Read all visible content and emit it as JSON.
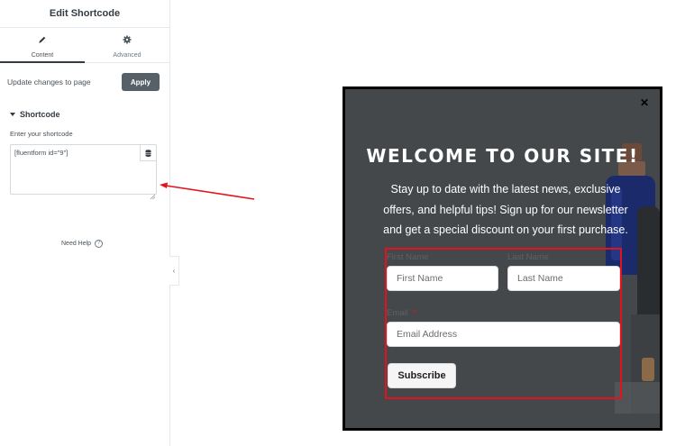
{
  "panel": {
    "title": "Edit Shortcode",
    "tabs": [
      {
        "label": "Content",
        "icon": "pencil-icon",
        "active": true
      },
      {
        "label": "Advanced",
        "icon": "gear-icon",
        "active": false
      }
    ],
    "update_label": "Update changes to page",
    "apply_label": "Apply",
    "section_title": "Shortcode",
    "field_label": "Enter your shortcode",
    "shortcode_value": "[fluentform id=\"9\"]",
    "help_label": "Need Help",
    "collapse_icon": "chevron-left-icon"
  },
  "annotation": {
    "arrow_color": "#e3131b"
  },
  "popup": {
    "close_icon": "close-icon",
    "title": "WELCOME TO OUR SITE!",
    "text": "Stay up to date with the latest news, exclusive offers, and helpful tips! Sign up for our newsletter and get a special discount on your first purchase.",
    "form": {
      "first_name_label": "First Name",
      "first_name_placeholder": "First Name",
      "last_name_label": "Last Name",
      "last_name_placeholder": "Last Name",
      "email_label": "Email",
      "email_required": "*",
      "email_placeholder": "Email Address",
      "submit_label": "Subscribe"
    },
    "colors": {
      "background": "#45484a",
      "highlight_border": "#e3131b"
    }
  }
}
